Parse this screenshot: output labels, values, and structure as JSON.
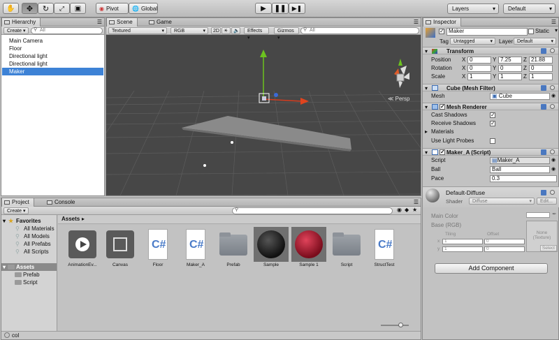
{
  "toolbar": {
    "tools": [
      "hand-tool",
      "move-tool",
      "rotate-tool",
      "scale-tool",
      "rect-tool"
    ],
    "pivot": "Pivot",
    "global": "Global",
    "layers": "Layers",
    "layout": "Default"
  },
  "hierarchy": {
    "tab": "Hierarchy",
    "create": "Create",
    "search_placeholder": "All",
    "items": [
      "Main Camera",
      "Floor",
      "Directional light",
      "Directional light",
      "Maker"
    ]
  },
  "scene": {
    "tab": "Scene",
    "game_tab": "Game",
    "shading": "Textured",
    "render": "RGB",
    "mode2d": "2D",
    "effects": "Effects",
    "gizmos": "Gizmos",
    "search_placeholder": "All",
    "persp": "Persp"
  },
  "project": {
    "tab": "Project",
    "console_tab": "Console",
    "create": "Create",
    "path": "Assets",
    "tree": [
      {
        "label": "Favorites",
        "bold": true
      },
      {
        "label": "All Materials"
      },
      {
        "label": "All Models"
      },
      {
        "label": "All Prefabs"
      },
      {
        "label": "All Scripts"
      },
      {
        "label": "Assets",
        "bold": true
      },
      {
        "label": "Prefab"
      },
      {
        "label": "Script"
      }
    ],
    "assets": [
      {
        "name": "AnimationEv...",
        "kind": "anim"
      },
      {
        "name": "Canvas",
        "kind": "canvas"
      },
      {
        "name": "Floor",
        "kind": "cs"
      },
      {
        "name": "Maker_A",
        "kind": "cs"
      },
      {
        "name": "Prefab",
        "kind": "folder"
      },
      {
        "name": "Sample",
        "kind": "black"
      },
      {
        "name": "Sample 1",
        "kind": "red"
      },
      {
        "name": "Script",
        "kind": "folder"
      },
      {
        "name": "StructTest",
        "kind": "cs"
      }
    ],
    "footer": "col"
  },
  "inspector": {
    "tab": "Inspector",
    "name": "Maker",
    "static": "Static",
    "tag_label": "Tag",
    "tag": "Untagged",
    "layer_label": "Layer",
    "layer": "Default",
    "transform": {
      "title": "Transform",
      "rows": [
        {
          "label": "Position",
          "x": "0",
          "y": "7.25",
          "z": "21.88"
        },
        {
          "label": "Rotation",
          "x": "0",
          "y": "0",
          "z": "0"
        },
        {
          "label": "Scale",
          "x": "1",
          "y": "1",
          "z": "1"
        }
      ]
    },
    "mesh_filter": {
      "title": "Cube (Mesh Filter)",
      "mesh_label": "Mesh",
      "mesh": "Cube"
    },
    "mesh_renderer": {
      "title": "Mesh Renderer",
      "cast": "Cast Shadows",
      "receive": "Receive Shadows",
      "materials": "Materials",
      "probes": "Use Light Probes"
    },
    "script": {
      "title": "Maker_A (Script)",
      "script_label": "Script",
      "script": "Maker_A",
      "ball_label": "Ball",
      "ball": "Ball",
      "pace_label": "Pace",
      "pace": "0.3"
    },
    "material": {
      "name": "Default-Diffuse",
      "shader_label": "Shader",
      "shader": "Diffuse",
      "edit": "Edit...",
      "main_color": "Main Color",
      "base": "Base (RGB)",
      "tiling": "Tiling",
      "offset": "Offset",
      "x": "x",
      "y": "y",
      "t1": "1",
      "t2": "1",
      "o1": "0",
      "o2": "0",
      "none": "None",
      "texture": "(Texture)",
      "select": "Select"
    },
    "add_component": "Add Component"
  }
}
